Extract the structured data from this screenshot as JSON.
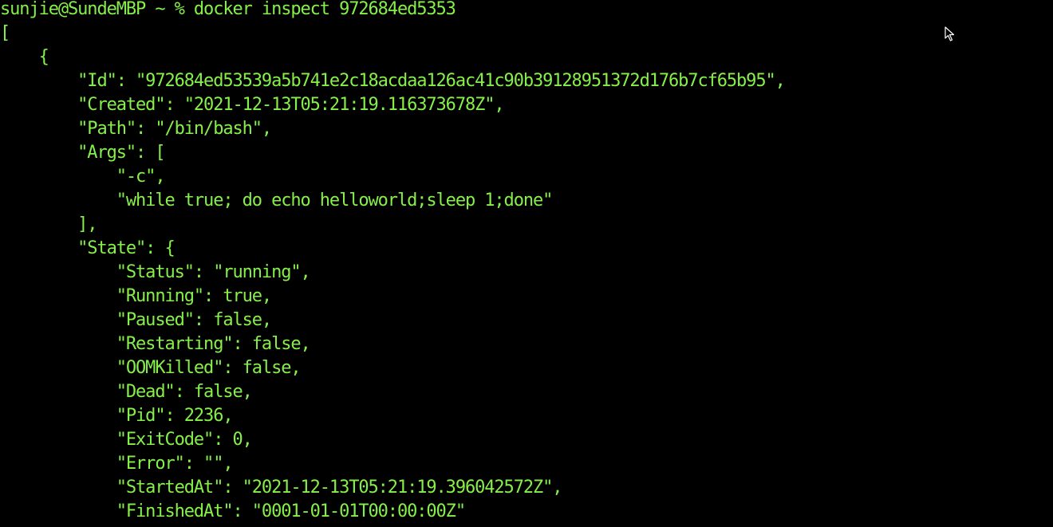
{
  "colors": {
    "background": "#000000",
    "text": "#86f04a"
  },
  "terminal": {
    "prompt": "sunjie@SundeMBP ~ % ",
    "command": "docker inspect 972684ed5353",
    "output": [
      "[",
      "    {",
      "        \"Id\": \"972684ed53539a5b741e2c18acdaa126ac41c90b39128951372d176b7cf65b95\",",
      "        \"Created\": \"2021-12-13T05:21:19.116373678Z\",",
      "        \"Path\": \"/bin/bash\",",
      "        \"Args\": [",
      "            \"-c\",",
      "            \"while true; do echo helloworld;sleep 1;done\"",
      "        ],",
      "        \"State\": {",
      "            \"Status\": \"running\",",
      "            \"Running\": true,",
      "            \"Paused\": false,",
      "            \"Restarting\": false,",
      "            \"OOMKilled\": false,",
      "            \"Dead\": false,",
      "            \"Pid\": 2236,",
      "            \"ExitCode\": 0,",
      "            \"Error\": \"\",",
      "            \"StartedAt\": \"2021-12-13T05:21:19.396042572Z\",",
      "            \"FinishedAt\": \"0001-01-01T00:00:00Z\"",
      "        },"
    ]
  },
  "mouse_cursor": {
    "icon": "arrow-pointer-icon"
  }
}
